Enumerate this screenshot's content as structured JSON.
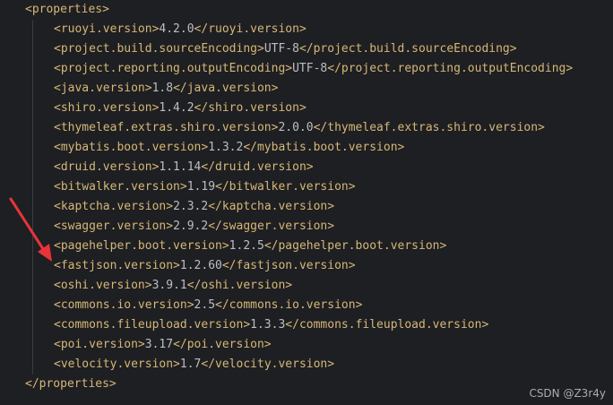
{
  "editor": {
    "open_tag": "<properties>",
    "close_tag": "</properties>",
    "entries": [
      {
        "name": "ruoyi.version",
        "value": "4.2.0"
      },
      {
        "name": "project.build.sourceEncoding",
        "value": "UTF-8"
      },
      {
        "name": "project.reporting.outputEncoding",
        "value": "UTF-8"
      },
      {
        "name": "java.version",
        "value": "1.8"
      },
      {
        "name": "shiro.version",
        "value": "1.4.2"
      },
      {
        "name": "thymeleaf.extras.shiro.version",
        "value": "2.0.0"
      },
      {
        "name": "mybatis.boot.version",
        "value": "1.3.2"
      },
      {
        "name": "druid.version",
        "value": "1.1.14"
      },
      {
        "name": "bitwalker.version",
        "value": "1.19"
      },
      {
        "name": "kaptcha.version",
        "value": "2.3.2"
      },
      {
        "name": "swagger.version",
        "value": "2.9.2"
      },
      {
        "name": "pagehelper.boot.version",
        "value": "1.2.5"
      },
      {
        "name": "fastjson.version",
        "value": "1.2.60"
      },
      {
        "name": "oshi.version",
        "value": "3.9.1"
      },
      {
        "name": "commons.io.version",
        "value": "2.5"
      },
      {
        "name": "commons.fileupload.version",
        "value": "1.3.3"
      },
      {
        "name": "poi.version",
        "value": "3.17"
      },
      {
        "name": "velocity.version",
        "value": "1.7"
      }
    ]
  },
  "watermark": "CSDN @Z3r4y",
  "colors": {
    "background": "#1e1f22",
    "tag": "#d5b778",
    "text": "#bcbec4",
    "arrow": "#e8333a"
  }
}
